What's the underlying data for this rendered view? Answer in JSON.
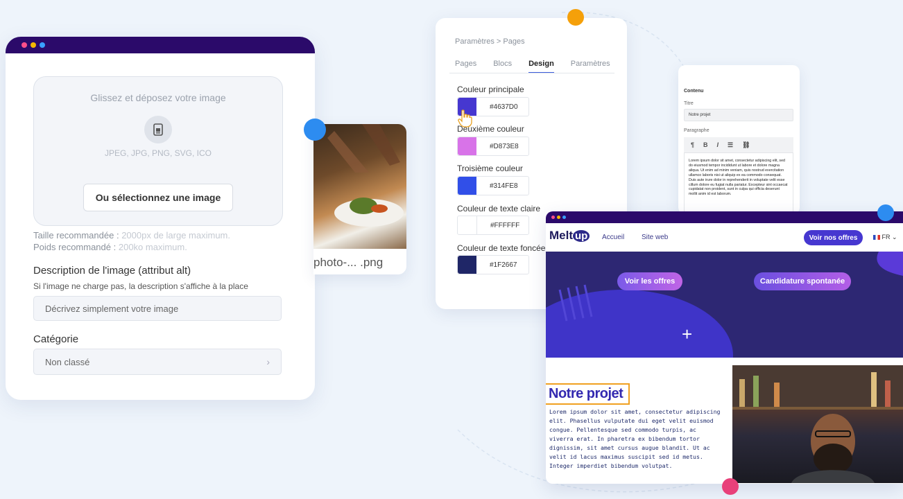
{
  "colors": {
    "accent_orange": "#F5A00A",
    "accent_blue": "#2D8CF0",
    "accent_pink": "#E8407A",
    "window_bar": "#2B0A6A"
  },
  "upload": {
    "drop_title": "Glissez et déposez votre image",
    "file_icon": "file-image-icon",
    "formats": "JPEG, JPG, PNG, SVG, ICO",
    "select_button": "Ou sélectionnez une image",
    "size_label": "Taille recommandée :",
    "size_value": "2000px de large maximum.",
    "weight_label": "Poids recommandé :",
    "weight_value": "200ko maximum.",
    "alt_title": "Description de l'image (attribut alt)",
    "alt_help": "Si l'image ne charge pas, la description s'affiche à la place",
    "alt_placeholder": "Décrivez simplement votre image",
    "category_title": "Catégorie",
    "category_value": "Non classé"
  },
  "photo_card": {
    "filename": "photo-... .png"
  },
  "settings": {
    "breadcrumb": "Paramètres  >  Pages",
    "tabs": [
      "Pages",
      "Blocs",
      "Design",
      "Paramètres"
    ],
    "active_tab": "Design",
    "colors": [
      {
        "label": "Couleur principale",
        "hex": "#4637D0"
      },
      {
        "label": "Deuxième couleur",
        "hex": "#D873E8"
      },
      {
        "label": "Troisième couleur",
        "hex": "#314FE8"
      },
      {
        "label": "Couleur de texte claire",
        "hex": "#FFFFFF"
      },
      {
        "label": "Couleur de texte foncée",
        "hex": "#1F2667"
      }
    ]
  },
  "editor": {
    "section": "Contenu",
    "title_label": "Titre",
    "title_value": "Notre projet",
    "para_label": "Paragraphe",
    "toolbar": [
      "¶",
      "B",
      "I",
      "☰",
      "🔗"
    ],
    "paragraph": "Lorem ipsum dolor sit amet, consectetur adipiscing elit, sed do eiusmod tempor incididunt ut labore et dolore magna aliqua. Ut enim ad minim veniam, quis nostrud exercitation ullamco laboris nisi ut aliquip ex ea commodo consequat. Duis aute irure dolor in reprehenderit in voluptate velit esse cillum dolore eu fugiat nulla pariatur. Excepteur sint occaecat cupidatat non proident, sunt in culpa qui officia deserunt mollit anim id est laborum."
  },
  "site": {
    "logo": "Melt",
    "logo_up": "up",
    "nav": [
      "Accueil",
      "Site web"
    ],
    "cta": "Voir nos offres",
    "lang": "FR",
    "hero_buttons": [
      "Voir les offres",
      "Candidature spontanée"
    ],
    "project_title": "Notre projet",
    "project_text": "Lorem ipsum dolor sit amet, consectetur adipiscing elit. Phasellus vulputate dui eget velit euismod congue. Pellentesque sed commodo turpis, ac viverra erat. In pharetra ex bibendum tortor dignissim, sit amet cursus augue blandit. Ut ac velit id lacus maximus suscipit sed id metus. Integer imperdiet bibendum volutpat."
  }
}
